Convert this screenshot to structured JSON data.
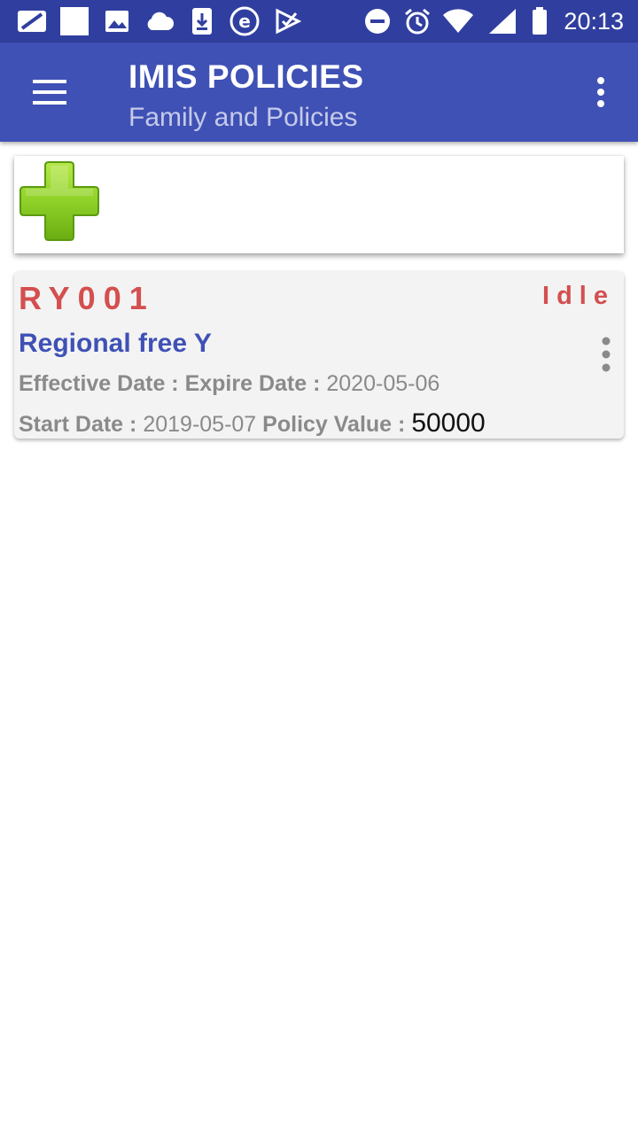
{
  "status_bar": {
    "time": "20:13",
    "icons": [
      "notification-icon",
      "square-icon",
      "image-icon",
      "cloud-icon",
      "download-icon",
      "e-app-icon",
      "check-app-icon",
      "do-not-disturb-icon",
      "alarm-icon",
      "wifi-icon",
      "signal-icon",
      "battery-icon"
    ]
  },
  "app_bar": {
    "title": "IMIS POLICIES",
    "subtitle": "Family and Policies"
  },
  "add_card": {
    "icon": "add-plus-icon",
    "accent": "#7cc01b"
  },
  "policies": [
    {
      "code": "RY001",
      "status": "Idle",
      "product": "Regional free Y",
      "effective_date_label": "Effective Date :",
      "effective_date": "",
      "expire_date_label": "Expire Date :",
      "expire_date": "2020-05-06",
      "start_date_label": "Start Date :",
      "start_date": "2019-05-07",
      "policy_value_label": "Policy Value :",
      "policy_value": "50000"
    }
  ],
  "colors": {
    "status_bar": "#303f9f",
    "app_bar": "#3f51b5",
    "code_red": "#d44f4f",
    "product_blue": "#3f51b5"
  }
}
